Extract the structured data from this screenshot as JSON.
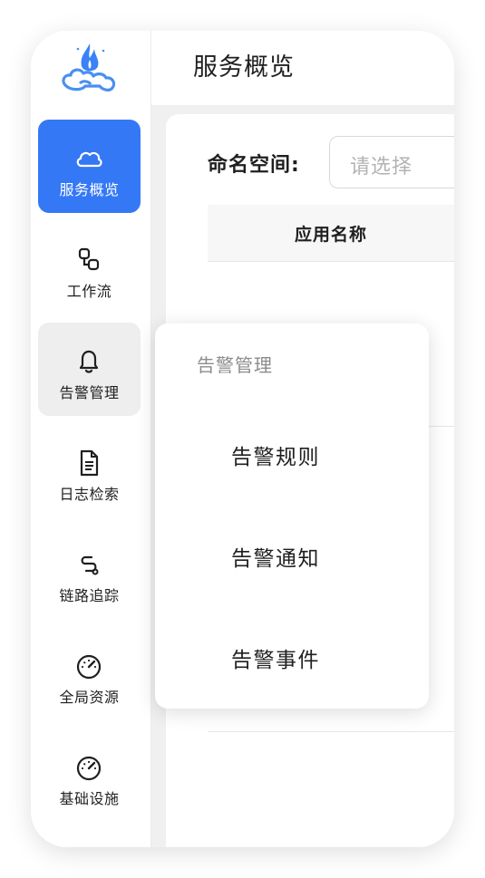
{
  "header": {
    "title": "服务概览"
  },
  "sidebar": {
    "items": [
      {
        "label": "服务概览",
        "icon": "cloud-icon",
        "state": "active"
      },
      {
        "label": "工作流",
        "icon": "workflow-icon"
      },
      {
        "label": "告警管理",
        "icon": "bell-icon",
        "state": "hover"
      },
      {
        "label": "日志检索",
        "icon": "document-icon"
      },
      {
        "label": "链路追踪",
        "icon": "route-icon"
      },
      {
        "label": "全局资源",
        "icon": "gauge-icon"
      },
      {
        "label": "基础设施",
        "icon": "gauge-icon"
      }
    ]
  },
  "filter": {
    "namespace_label": "命名空间:",
    "namespace_placeholder": "请选择"
  },
  "table": {
    "columns": [
      "应用名称"
    ]
  },
  "popover": {
    "group_title": "告警管理",
    "items": [
      "告警规则",
      "告警通知",
      "告警事件"
    ]
  },
  "colors": {
    "accent": "#3478f6",
    "logo": "#4a8ff0",
    "flame": "#3b82f6"
  }
}
